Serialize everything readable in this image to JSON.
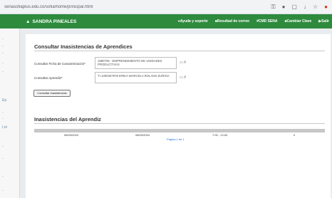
{
  "browser": {
    "url": "senasofiaplus.edu.co/sofia/home/principal.html",
    "icons": [
      "key-icon",
      "shield-icon",
      "tab-icon",
      "download-icon",
      "star-icon",
      "profile-icon"
    ]
  },
  "header": {
    "user_name": "SANDRA PINEALES",
    "nav": [
      {
        "label": "Ayuda y soporte",
        "icon": "help-icon"
      },
      {
        "label": "Resultad de correo",
        "icon": "mail-icon"
      },
      {
        "label": "CMD SENA",
        "icon": "home-icon"
      },
      {
        "label": "Cambiar Clave",
        "icon": "key-icon"
      },
      {
        "label": "Salir",
        "icon": "exit-icon"
      }
    ],
    "colors": {
      "header": "#2e8b3e"
    }
  },
  "sidebar": {
    "items": [
      "-",
      "-",
      "-",
      "-",
      "-",
      "Ep",
      "-",
      "-",
      "Lnt",
      "-",
      "-",
      "-",
      "-"
    ]
  },
  "form": {
    "title": "Consultar Inasistencias de Aprendices",
    "ficha_label": "Consultar Ficha de Caracterización*",
    "ficha_value": "1980755 - EMPRENDIMIENTO DE UNIDADES PRODUCTIVAS",
    "aprendiz_label": "Consultar Aprendiz*",
    "aprendiz_value": "TI 1000267978 ERIKA MARCELA ROLANS ZUÑIGA",
    "tool_icon": "▭ #",
    "button_label": "Consultar Inasistencias"
  },
  "results": {
    "title": "Inasistencias del Aprendiz",
    "row": [
      "06/03/2024",
      "06/03/2024",
      "7:00 - 12:00",
      "0"
    ],
    "pager": "Página 1 de 1"
  }
}
